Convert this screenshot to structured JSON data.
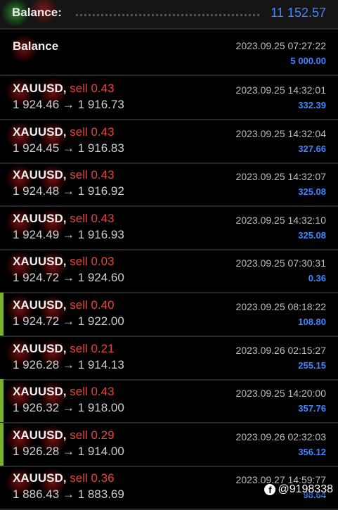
{
  "header": {
    "label": "Balance:",
    "value": "11 152.57"
  },
  "deposit": {
    "title": "Balance",
    "date": "2023.09.25 07:27:22",
    "amount": "5 000.00"
  },
  "trades": [
    {
      "symbol": "XAUUSD,",
      "side": "sell 0.43",
      "open": "1 924.46",
      "close": "1 916.73",
      "date": "2023.09.25 14:32:01",
      "profit": "332.39"
    },
    {
      "symbol": "XAUUSD,",
      "side": "sell 0.43",
      "open": "1 924.45",
      "close": "1 916.83",
      "date": "2023.09.25 14:32:04",
      "profit": "327.66"
    },
    {
      "symbol": "XAUUSD,",
      "side": "sell 0.43",
      "open": "1 924.48",
      "close": "1 916.92",
      "date": "2023.09.25 14:32:07",
      "profit": "325.08"
    },
    {
      "symbol": "XAUUSD,",
      "side": "sell 0.43",
      "open": "1 924.49",
      "close": "1 916.93",
      "date": "2023.09.25 14:32:10",
      "profit": "325.08"
    },
    {
      "symbol": "XAUUSD,",
      "side": "sell 0.03",
      "open": "1 924.72",
      "close": "1 924.60",
      "date": "2023.09.25 07:30:31",
      "profit": "0.36"
    },
    {
      "symbol": "XAUUSD,",
      "side": "sell 0.40",
      "open": "1 924.72",
      "close": "1 922.00",
      "date": "2023.09.25 08:18:22",
      "profit": "108.80"
    },
    {
      "symbol": "XAUUSD,",
      "side": "sell 0.21",
      "open": "1 926.28",
      "close": "1 914.13",
      "date": "2023.09.26 02:15:27",
      "profit": "255.15"
    },
    {
      "symbol": "XAUUSD,",
      "side": "sell 0.43",
      "open": "1 926.32",
      "close": "1 918.00",
      "date": "2023.09.25 14:20:00",
      "profit": "357.76"
    },
    {
      "symbol": "XAUUSD,",
      "side": "sell 0.29",
      "open": "1 926.28",
      "close": "1 914.00",
      "date": "2023.09.26 02:32:03",
      "profit": "356.12"
    },
    {
      "symbol": "XAUUSD,",
      "side": "sell 0.36",
      "open": "1 886.43",
      "close": "1 883.69",
      "date": "2023.09.27 14:59:77",
      "profit": "98.64"
    }
  ],
  "arrow": "→",
  "watermark": {
    "icon": "facebook-icon",
    "text": "@9198338"
  },
  "colors": {
    "profit": "#3f86ff",
    "sell": "#e8443a",
    "accent": "#79b12c",
    "background": "#000000"
  }
}
